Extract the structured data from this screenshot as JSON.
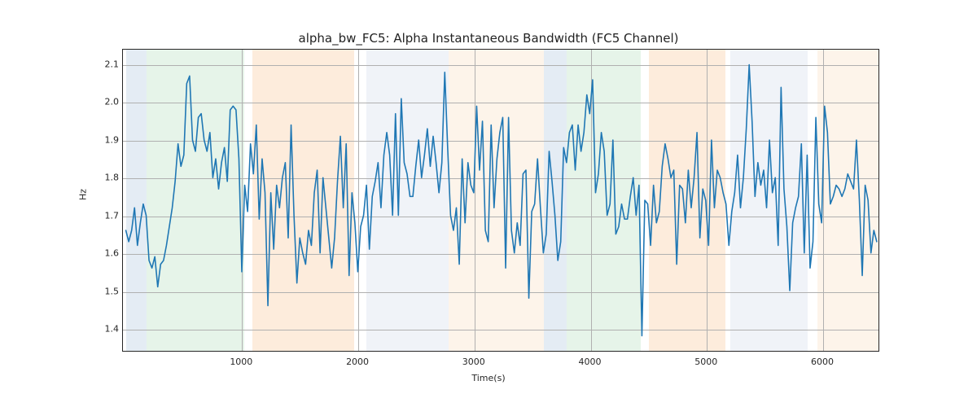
{
  "chart_data": {
    "type": "line",
    "title": "alpha_bw_FC5: Alpha Instantaneous Bandwidth (FC5 Channel)",
    "xlabel": "Time(s)",
    "ylabel": "Hz",
    "xlim": [
      -25,
      6490
    ],
    "ylim": [
      1.34,
      2.14
    ],
    "x_ticks": [
      1000,
      2000,
      3000,
      4000,
      5000,
      6000
    ],
    "y_ticks": [
      1.4,
      1.5,
      1.6,
      1.7,
      1.8,
      1.9,
      2.0,
      2.1
    ],
    "line_color": "#1f77b4",
    "bands": [
      {
        "start": 0,
        "end": 175,
        "color": "#b3c9df"
      },
      {
        "start": 175,
        "end": 1020,
        "color": "#b7e0c0"
      },
      {
        "start": 1090,
        "end": 1965,
        "color": "#f8c99a"
      },
      {
        "start": 2070,
        "end": 2780,
        "color": "#d3dcec"
      },
      {
        "start": 2780,
        "end": 3600,
        "color": "#fadfc3"
      },
      {
        "start": 3600,
        "end": 3790,
        "color": "#b3c9df"
      },
      {
        "start": 3790,
        "end": 4430,
        "color": "#b7e0c0"
      },
      {
        "start": 4500,
        "end": 5160,
        "color": "#f8c99a"
      },
      {
        "start": 5200,
        "end": 5870,
        "color": "#d3dcec"
      },
      {
        "start": 5950,
        "end": 6490,
        "color": "#fadfc3"
      }
    ],
    "x": [
      0,
      25,
      50,
      75,
      100,
      125,
      150,
      175,
      200,
      225,
      250,
      275,
      300,
      325,
      350,
      375,
      400,
      425,
      450,
      475,
      500,
      525,
      550,
      575,
      600,
      625,
      650,
      675,
      700,
      725,
      750,
      775,
      800,
      825,
      850,
      875,
      900,
      925,
      950,
      975,
      1000,
      1025,
      1050,
      1075,
      1100,
      1125,
      1150,
      1175,
      1200,
      1225,
      1250,
      1275,
      1300,
      1325,
      1350,
      1375,
      1400,
      1425,
      1450,
      1475,
      1500,
      1525,
      1550,
      1575,
      1600,
      1625,
      1650,
      1675,
      1700,
      1725,
      1750,
      1775,
      1800,
      1825,
      1850,
      1875,
      1900,
      1925,
      1950,
      1975,
      2000,
      2025,
      2050,
      2075,
      2100,
      2125,
      2150,
      2175,
      2200,
      2225,
      2250,
      2275,
      2300,
      2325,
      2350,
      2375,
      2400,
      2425,
      2450,
      2475,
      2500,
      2525,
      2550,
      2575,
      2600,
      2625,
      2650,
      2675,
      2700,
      2725,
      2750,
      2775,
      2800,
      2825,
      2850,
      2875,
      2900,
      2925,
      2950,
      2975,
      3000,
      3025,
      3050,
      3075,
      3100,
      3125,
      3150,
      3175,
      3200,
      3225,
      3250,
      3275,
      3300,
      3325,
      3350,
      3375,
      3400,
      3425,
      3450,
      3475,
      3500,
      3525,
      3550,
      3575,
      3600,
      3625,
      3650,
      3675,
      3700,
      3725,
      3750,
      3775,
      3800,
      3825,
      3850,
      3875,
      3900,
      3925,
      3950,
      3975,
      4000,
      4025,
      4050,
      4075,
      4100,
      4125,
      4150,
      4175,
      4200,
      4225,
      4250,
      4275,
      4300,
      4325,
      4350,
      4375,
      4400,
      4425,
      4450,
      4475,
      4500,
      4525,
      4550,
      4575,
      4600,
      4625,
      4650,
      4675,
      4700,
      4725,
      4750,
      4775,
      4800,
      4825,
      4850,
      4875,
      4900,
      4925,
      4950,
      4975,
      5000,
      5025,
      5050,
      5075,
      5100,
      5125,
      5150,
      5175,
      5200,
      5225,
      5250,
      5275,
      5300,
      5325,
      5350,
      5375,
      5400,
      5425,
      5450,
      5475,
      5500,
      5525,
      5550,
      5575,
      5600,
      5625,
      5650,
      5675,
      5700,
      5725,
      5750,
      5775,
      5800,
      5825,
      5850,
      5875,
      5900,
      5925,
      5950,
      5975,
      6000,
      6025,
      6050,
      6075,
      6100,
      6125,
      6150,
      6175,
      6200,
      6225,
      6250,
      6275,
      6300,
      6325,
      6350,
      6375,
      6400,
      6425,
      6450,
      6475
    ],
    "values": [
      1.66,
      1.63,
      1.66,
      1.72,
      1.62,
      1.68,
      1.73,
      1.7,
      1.58,
      1.56,
      1.59,
      1.51,
      1.57,
      1.58,
      1.62,
      1.67,
      1.72,
      1.79,
      1.89,
      1.83,
      1.86,
      2.05,
      2.07,
      1.9,
      1.87,
      1.96,
      1.97,
      1.9,
      1.87,
      1.92,
      1.8,
      1.85,
      1.77,
      1.84,
      1.88,
      1.79,
      1.98,
      1.99,
      1.98,
      1.85,
      1.55,
      1.78,
      1.71,
      1.89,
      1.81,
      1.94,
      1.69,
      1.85,
      1.76,
      1.46,
      1.76,
      1.61,
      1.78,
      1.72,
      1.8,
      1.84,
      1.64,
      1.94,
      1.7,
      1.52,
      1.64,
      1.6,
      1.57,
      1.66,
      1.62,
      1.76,
      1.82,
      1.6,
      1.8,
      1.72,
      1.64,
      1.56,
      1.64,
      1.79,
      1.91,
      1.72,
      1.89,
      1.54,
      1.76,
      1.68,
      1.55,
      1.67,
      1.7,
      1.78,
      1.61,
      1.75,
      1.79,
      1.84,
      1.72,
      1.86,
      1.92,
      1.86,
      1.7,
      1.97,
      1.7,
      2.01,
      1.84,
      1.81,
      1.75,
      1.75,
      1.83,
      1.9,
      1.8,
      1.86,
      1.93,
      1.83,
      1.91,
      1.84,
      1.76,
      1.84,
      2.08,
      1.88,
      1.7,
      1.66,
      1.72,
      1.57,
      1.85,
      1.68,
      1.84,
      1.78,
      1.76,
      1.99,
      1.82,
      1.95,
      1.66,
      1.63,
      1.94,
      1.72,
      1.85,
      1.92,
      1.96,
      1.56,
      1.96,
      1.66,
      1.6,
      1.68,
      1.62,
      1.81,
      1.82,
      1.48,
      1.71,
      1.73,
      1.85,
      1.72,
      1.6,
      1.65,
      1.87,
      1.79,
      1.7,
      1.58,
      1.63,
      1.88,
      1.84,
      1.92,
      1.94,
      1.82,
      1.94,
      1.87,
      1.92,
      2.02,
      1.97,
      2.06,
      1.76,
      1.81,
      1.92,
      1.87,
      1.7,
      1.73,
      1.9,
      1.65,
      1.67,
      1.73,
      1.69,
      1.69,
      1.75,
      1.8,
      1.7,
      1.78,
      1.38,
      1.74,
      1.73,
      1.62,
      1.78,
      1.68,
      1.71,
      1.83,
      1.89,
      1.85,
      1.8,
      1.82,
      1.57,
      1.78,
      1.77,
      1.68,
      1.82,
      1.72,
      1.8,
      1.92,
      1.64,
      1.77,
      1.74,
      1.62,
      1.9,
      1.72,
      1.82,
      1.8,
      1.76,
      1.73,
      1.62,
      1.71,
      1.76,
      1.86,
      1.72,
      1.8,
      1.93,
      2.1,
      1.95,
      1.75,
      1.84,
      1.78,
      1.82,
      1.72,
      1.9,
      1.76,
      1.8,
      1.62,
      2.04,
      1.77,
      1.67,
      1.5,
      1.68,
      1.72,
      1.75,
      1.89,
      1.6,
      1.86,
      1.56,
      1.63,
      1.96,
      1.73,
      1.68,
      1.99,
      1.92,
      1.73,
      1.75,
      1.78,
      1.77,
      1.75,
      1.77,
      1.81,
      1.79,
      1.77,
      1.9,
      1.74,
      1.54,
      1.78,
      1.74,
      1.6,
      1.66,
      1.63
    ]
  }
}
